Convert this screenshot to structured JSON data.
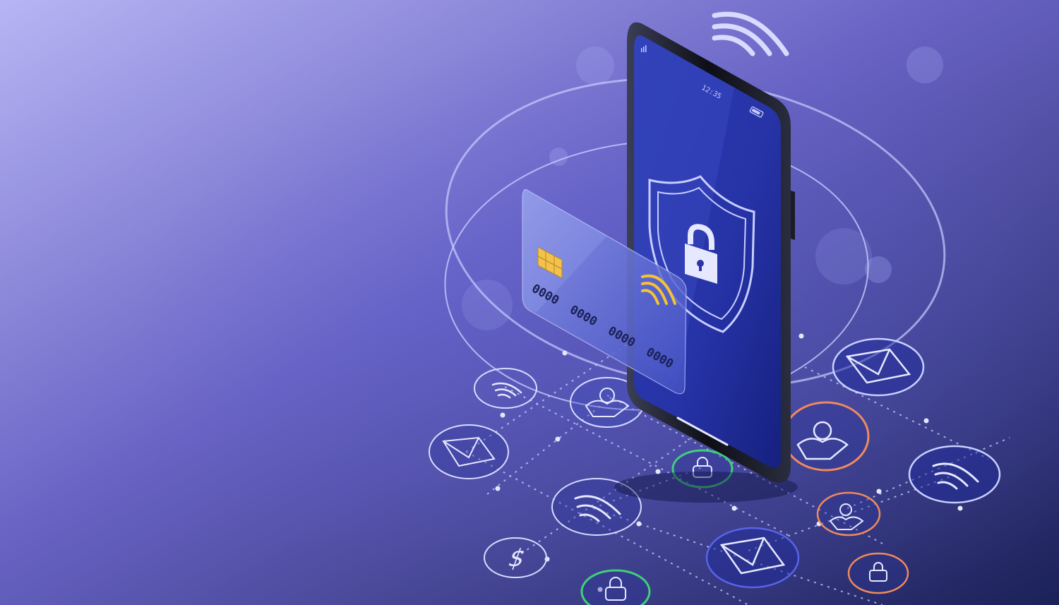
{
  "phone": {
    "time": "12:35"
  },
  "card": {
    "number_groups": [
      "0000",
      "0000",
      "0000",
      "0000"
    ]
  },
  "colors": {
    "bg_light": "#B4B2F2",
    "bg_mid": "#6F6AC8",
    "bg_dark": "#1D2460",
    "ring": "#C9CCFF",
    "node_blue": "#5A63E8",
    "node_orange": "#F08A5C",
    "node_green": "#3FD07A",
    "chip_gold": "#F2C24A",
    "nfc_gold": "#F5C234"
  },
  "icons": {
    "phone_screen": [
      "shield-icon",
      "padlock-icon",
      "wifi-icon",
      "battery-icon"
    ],
    "card": [
      "chip-icon",
      "contactless-icon"
    ],
    "network_nodes": [
      "mail-icon",
      "wifi-icon",
      "user-icon",
      "padlock-icon",
      "dollar-icon"
    ]
  }
}
